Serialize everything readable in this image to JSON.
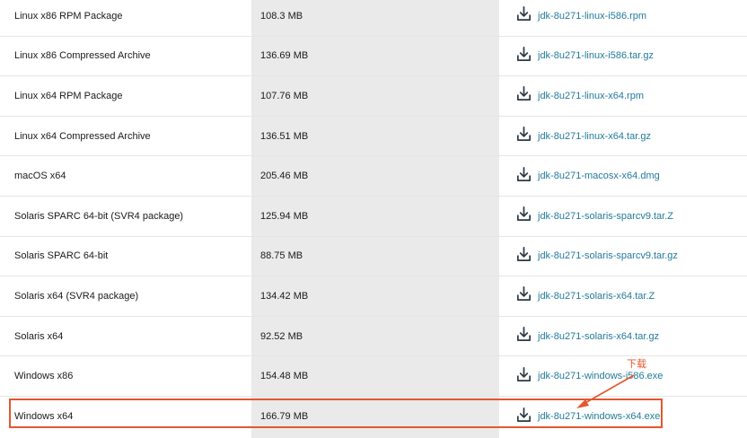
{
  "downloads": {
    "rows": [
      {
        "name": "Linux x86 RPM Package",
        "size": "108.3 MB",
        "file": "jdk-8u271-linux-i586.rpm"
      },
      {
        "name": "Linux x86 Compressed Archive",
        "size": "136.69 MB",
        "file": "jdk-8u271-linux-i586.tar.gz"
      },
      {
        "name": "Linux x64 RPM Package",
        "size": "107.76 MB",
        "file": "jdk-8u271-linux-x64.rpm"
      },
      {
        "name": "Linux x64 Compressed Archive",
        "size": "136.51 MB",
        "file": "jdk-8u271-linux-x64.tar.gz"
      },
      {
        "name": "macOS x64",
        "size": "205.46 MB",
        "file": "jdk-8u271-macosx-x64.dmg"
      },
      {
        "name": "Solaris SPARC 64-bit (SVR4 package)",
        "size": "125.94 MB",
        "file": "jdk-8u271-solaris-sparcv9.tar.Z"
      },
      {
        "name": "Solaris SPARC 64-bit",
        "size": "88.75 MB",
        "file": "jdk-8u271-solaris-sparcv9.tar.gz"
      },
      {
        "name": "Solaris x64 (SVR4 package)",
        "size": "134.42 MB",
        "file": "jdk-8u271-solaris-x64.tar.Z"
      },
      {
        "name": "Solaris x64",
        "size": "92.52 MB",
        "file": "jdk-8u271-solaris-x64.tar.gz"
      },
      {
        "name": "Windows x86",
        "size": "154.48 MB",
        "file": "jdk-8u271-windows-i586.exe"
      },
      {
        "name": "Windows x64",
        "size": "166.79 MB",
        "file": "jdk-8u271-windows-x64.exe"
      }
    ],
    "icon": "download-icon"
  },
  "annotation": {
    "text": "下载",
    "color": "#e4572e"
  },
  "colors": {
    "link": "#227a9a",
    "size_column_bg": "#eaeaea",
    "highlight": "#e4572e"
  }
}
